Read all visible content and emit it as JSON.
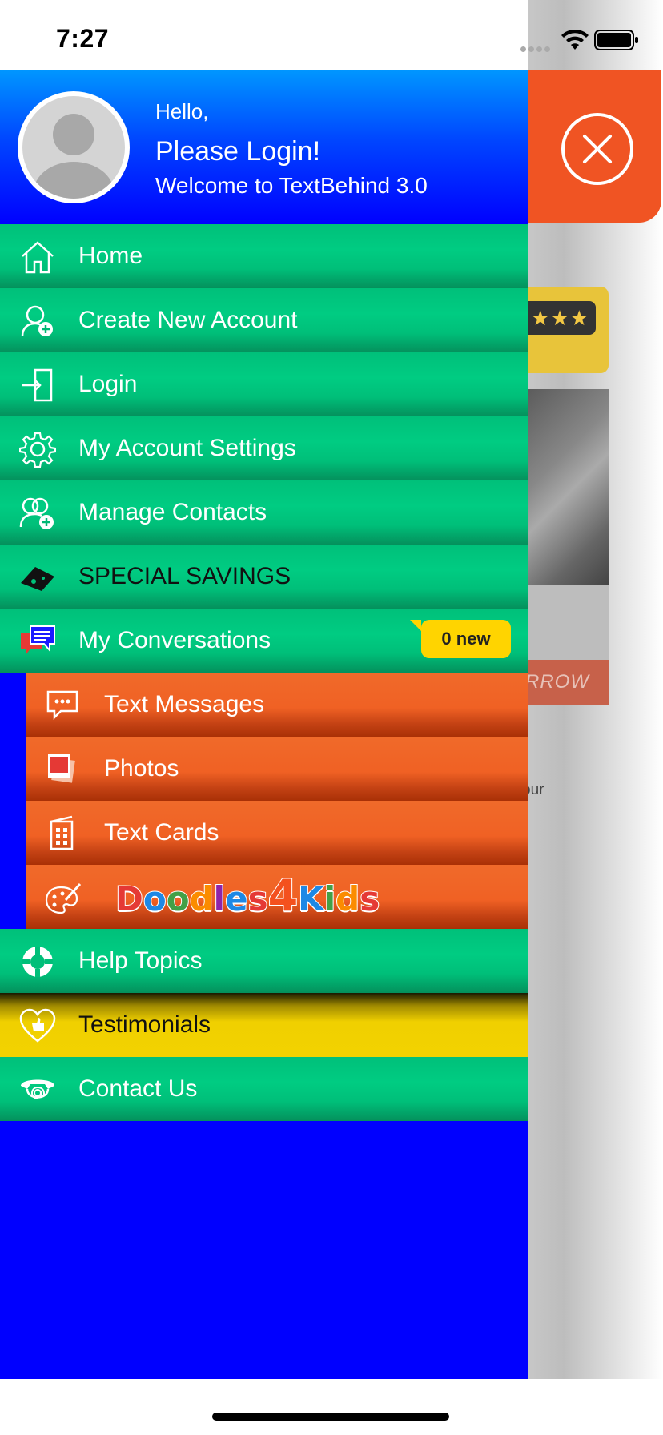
{
  "status_bar": {
    "time": "7:27"
  },
  "background": {
    "banner_text": "RROW",
    "body_text": "our",
    "rating_stars": "★★★"
  },
  "profile": {
    "greeting": "Hello,",
    "title": "Please Login!",
    "welcome": "Welcome to TextBehind 3.0"
  },
  "menu": {
    "home": "Home",
    "create_account": "Create New Account",
    "login": "Login",
    "account_settings": "My Account Settings",
    "manage_contacts": "Manage Contacts",
    "special_savings": "SPECIAL SAVINGS",
    "conversations": "My Conversations",
    "conversations_badge": "0 new",
    "text_messages": "Text Messages",
    "photos": "Photos",
    "text_cards": "Text Cards",
    "doodles": "Doodles4Kids",
    "help_topics": "Help Topics",
    "testimonials": "Testimonials",
    "contact_us": "Contact Us"
  },
  "colors": {
    "drawer_bg": "#0000ff",
    "menu_green": "#00c07a",
    "submenu_orange": "#f06124",
    "testimonials_yellow": "#f2d200",
    "badge_yellow": "#ffd400",
    "header_orange": "#f05423"
  },
  "icons": {
    "home": "home-icon",
    "create_account": "add-user-icon",
    "login": "login-door-icon",
    "account_settings": "gear-icon",
    "manage_contacts": "contacts-icon",
    "special_savings": "gamepad-icon",
    "conversations": "chat-bubbles-icon",
    "text_messages": "message-icon",
    "photos": "photo-icon",
    "text_cards": "card-icon",
    "doodles": "palette-icon",
    "help_topics": "lifebuoy-icon",
    "testimonials": "heart-thumb-icon",
    "contact_us": "phone-at-icon",
    "close": "close-icon"
  }
}
